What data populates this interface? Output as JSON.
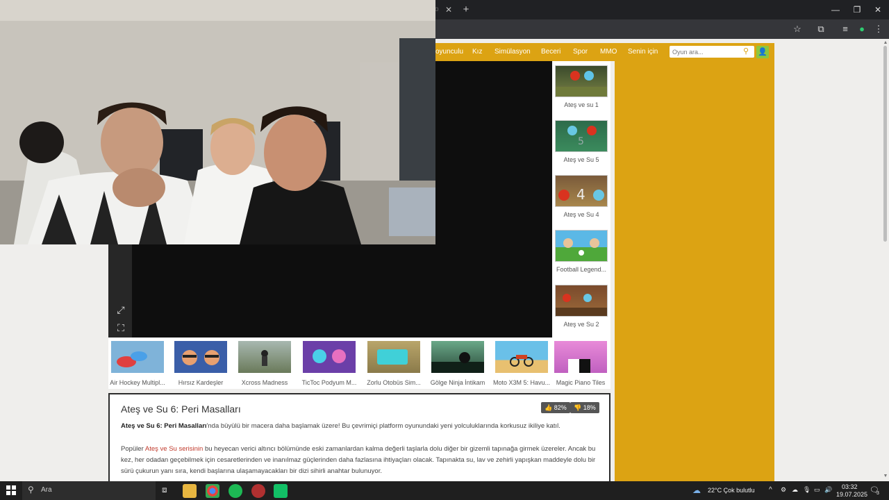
{
  "browser": {
    "close_tab": "✕",
    "new_tab": "+",
    "minimize": "—",
    "restore": "❐",
    "close_window": "✕"
  },
  "nav": {
    "items": [
      "oyunculu",
      "Kız",
      "Simülasyon",
      "Beceri",
      "Spor",
      "MMO",
      "Senin için"
    ],
    "search_placeholder": "Oyun ara..."
  },
  "side_games": [
    {
      "label": "Ateş ve su 1"
    },
    {
      "label": "Ateş ve Su 5"
    },
    {
      "label": "Ateş ve Su 4"
    },
    {
      "label": "Football Legend..."
    },
    {
      "label": "Ateş ve Su 2"
    }
  ],
  "bottom_games": [
    {
      "label": "Air Hockey Multipl..."
    },
    {
      "label": "Hırsız Kardeşler"
    },
    {
      "label": "Xcross Madness"
    },
    {
      "label": "TicToc Podyum M..."
    },
    {
      "label": "Zorlu Otobüs Sim..."
    },
    {
      "label": "Gölge Ninja İntikam"
    },
    {
      "label": "Moto X3M 5: Havu..."
    },
    {
      "label": "Magic Piano Tiles"
    }
  ],
  "game": {
    "title": "Ateş ve Su 6: Peri Masalları",
    "likes": "82%",
    "dislikes": "18%",
    "intro_bold": "Ateş ve Su 6: Peri Masalları",
    "intro_rest": "'nda büyülü bir macera daha başlamak üzere! Bu çevrimiçi platform oyunundaki yeni yolculuklarında korkusuz ikiliye katıl.",
    "p2_a": "Popüler ",
    "p2_link": "Ateş ve Su serisinin",
    "p2_b": " bu heyecan verici altıncı bölümünde eski zamanlardan kalma değerli taşlarla dolu diğer bir gizemli tapınağa girmek üzereler. Ancak bu kez, her odadan geçebilmek için cesaretlerinden ve inanılmaz güçlerinden daha fazlasına ihtiyaçları olacak. Tapınakta su, lav ve zehirli yapışkan maddeyle dolu bir sürü çukurun yanı sıra, kendi başlarına ulaşamayacakları bir dizi sihirli anahtar bulunuyor."
  },
  "taskbar": {
    "search": "Ara",
    "weather": "22°C  Çok bulutlu",
    "time": "03:32",
    "date": "19.07.2025",
    "notifications": "3"
  },
  "colors": {
    "accent": "#dca313",
    "nav_text": "#ffffff",
    "link": "#c0392b"
  }
}
